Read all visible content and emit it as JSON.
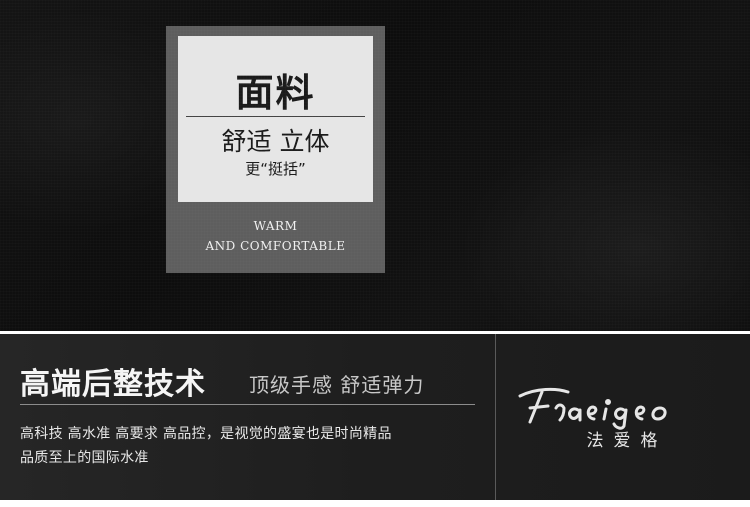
{
  "card": {
    "title": "面料",
    "subtitle": "舒适 立体",
    "note": "更“挺括”",
    "english_line1": "WARM",
    "english_line2": "AND COMFORTABLE"
  },
  "banner": {
    "headline": "高端后整技术",
    "tagline": "顶级手感 舒适弹力",
    "body_line1": "高科技 高水准 高要求 高品控，是视觉的盛宴也是时尚精品",
    "body_line2": "品质至上的国际水准"
  },
  "brand": {
    "wordmark": "Fraeigeo",
    "chinese_name": "法爱格"
  }
}
